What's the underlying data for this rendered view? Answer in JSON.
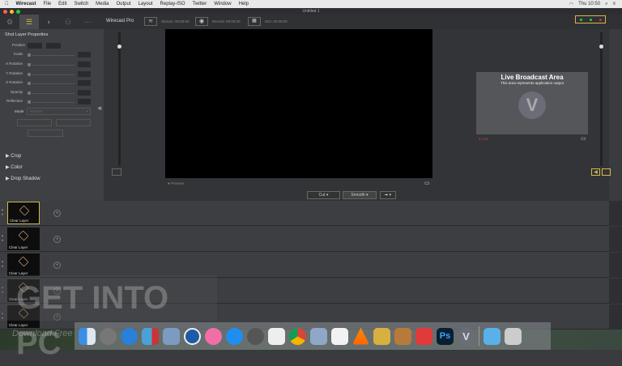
{
  "menubar": {
    "app": "Wirecast",
    "items": [
      "File",
      "Edit",
      "Switch",
      "Media",
      "Output",
      "Layout",
      "Replay-ISO",
      "Twitter",
      "Window",
      "Help"
    ],
    "clock": "Thu 10:50"
  },
  "window": {
    "title": "Untitled 1"
  },
  "toolbar": {
    "brand": "Wirecast Pro",
    "stream": "Stream: 00:00:00",
    "record": "Record: 00:00:00",
    "iso": "ISO: 00:00:00"
  },
  "properties": {
    "title": "Shot Layer Properties",
    "rows": [
      "Position",
      "Scale",
      "X Rotation",
      "Y Rotation",
      "Z Rotation",
      "Opacity",
      "Reflection"
    ],
    "mode_label": "Mode",
    "mode_value": "Normal",
    "sections": [
      "Crop",
      "Color",
      "Drop Shadow"
    ]
  },
  "preview": {
    "label": "Preview"
  },
  "live": {
    "title": "Live Broadcast Area",
    "subtitle": "This area represents application output",
    "label": "Live"
  },
  "transitions": {
    "cut": "Cut",
    "smooth": "Smooth"
  },
  "layers": [
    {
      "label": "Clear Layer"
    },
    {
      "label": "Clear Layer"
    },
    {
      "label": "Clear Layer"
    },
    {
      "label": "Clear Layer"
    },
    {
      "label": "Clear Layer"
    }
  ],
  "dock": {
    "icons": [
      "finder",
      "launchpad",
      "safari",
      "photo-booth",
      "preview",
      "1password",
      "itunes",
      "app-store",
      "system-preferences",
      "textedit",
      "chrome",
      "image-capture",
      "notes",
      "vlc",
      "transmit",
      "archive-utility",
      "pocket",
      "photoshop",
      "wirecast",
      "folder",
      "trash"
    ],
    "photoshop_label": "Ps"
  },
  "watermark": {
    "text": "GET INTO PC",
    "sub": "Download Free"
  },
  "colors": {
    "accent": "#d4b84a",
    "live_red": "#d33",
    "preview_green": "#3c3"
  }
}
